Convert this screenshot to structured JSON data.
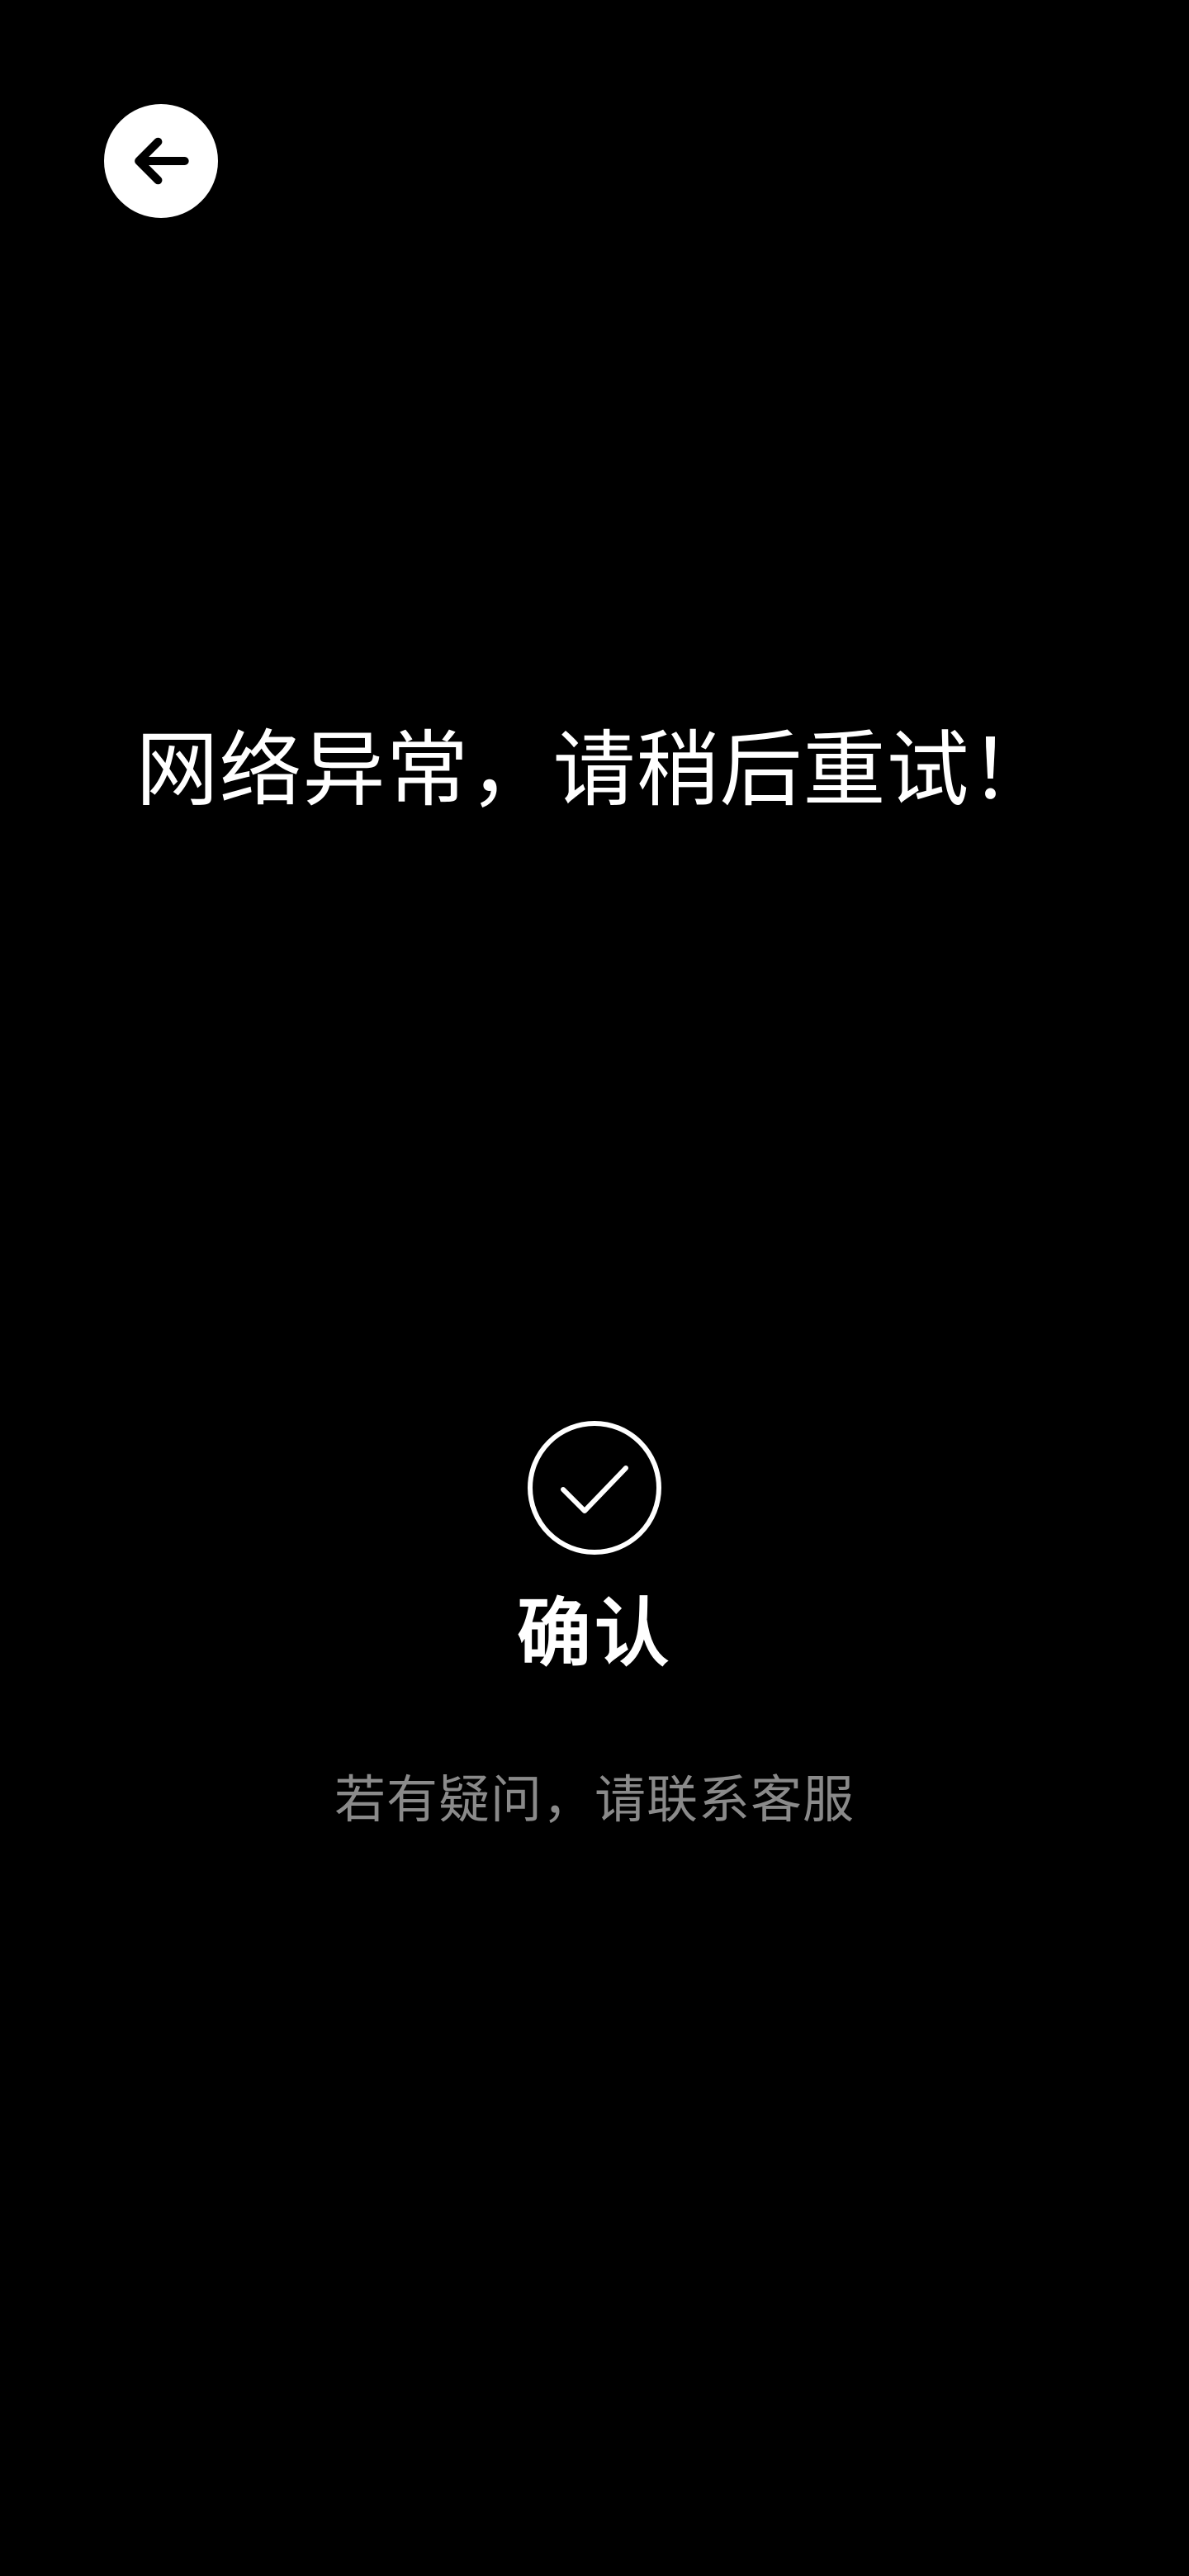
{
  "header": {
    "back_icon": "arrow-left-icon"
  },
  "main": {
    "error_message": "网络异常，请稍后重试！",
    "confirm_icon": "check-circle-icon",
    "confirm_label": "确认",
    "contact_hint": "若有疑问，请联系客服"
  },
  "colors": {
    "background": "#000000",
    "primary_text": "#ffffff",
    "secondary_text": "#8a8a8a",
    "back_button_bg": "#ffffff"
  }
}
